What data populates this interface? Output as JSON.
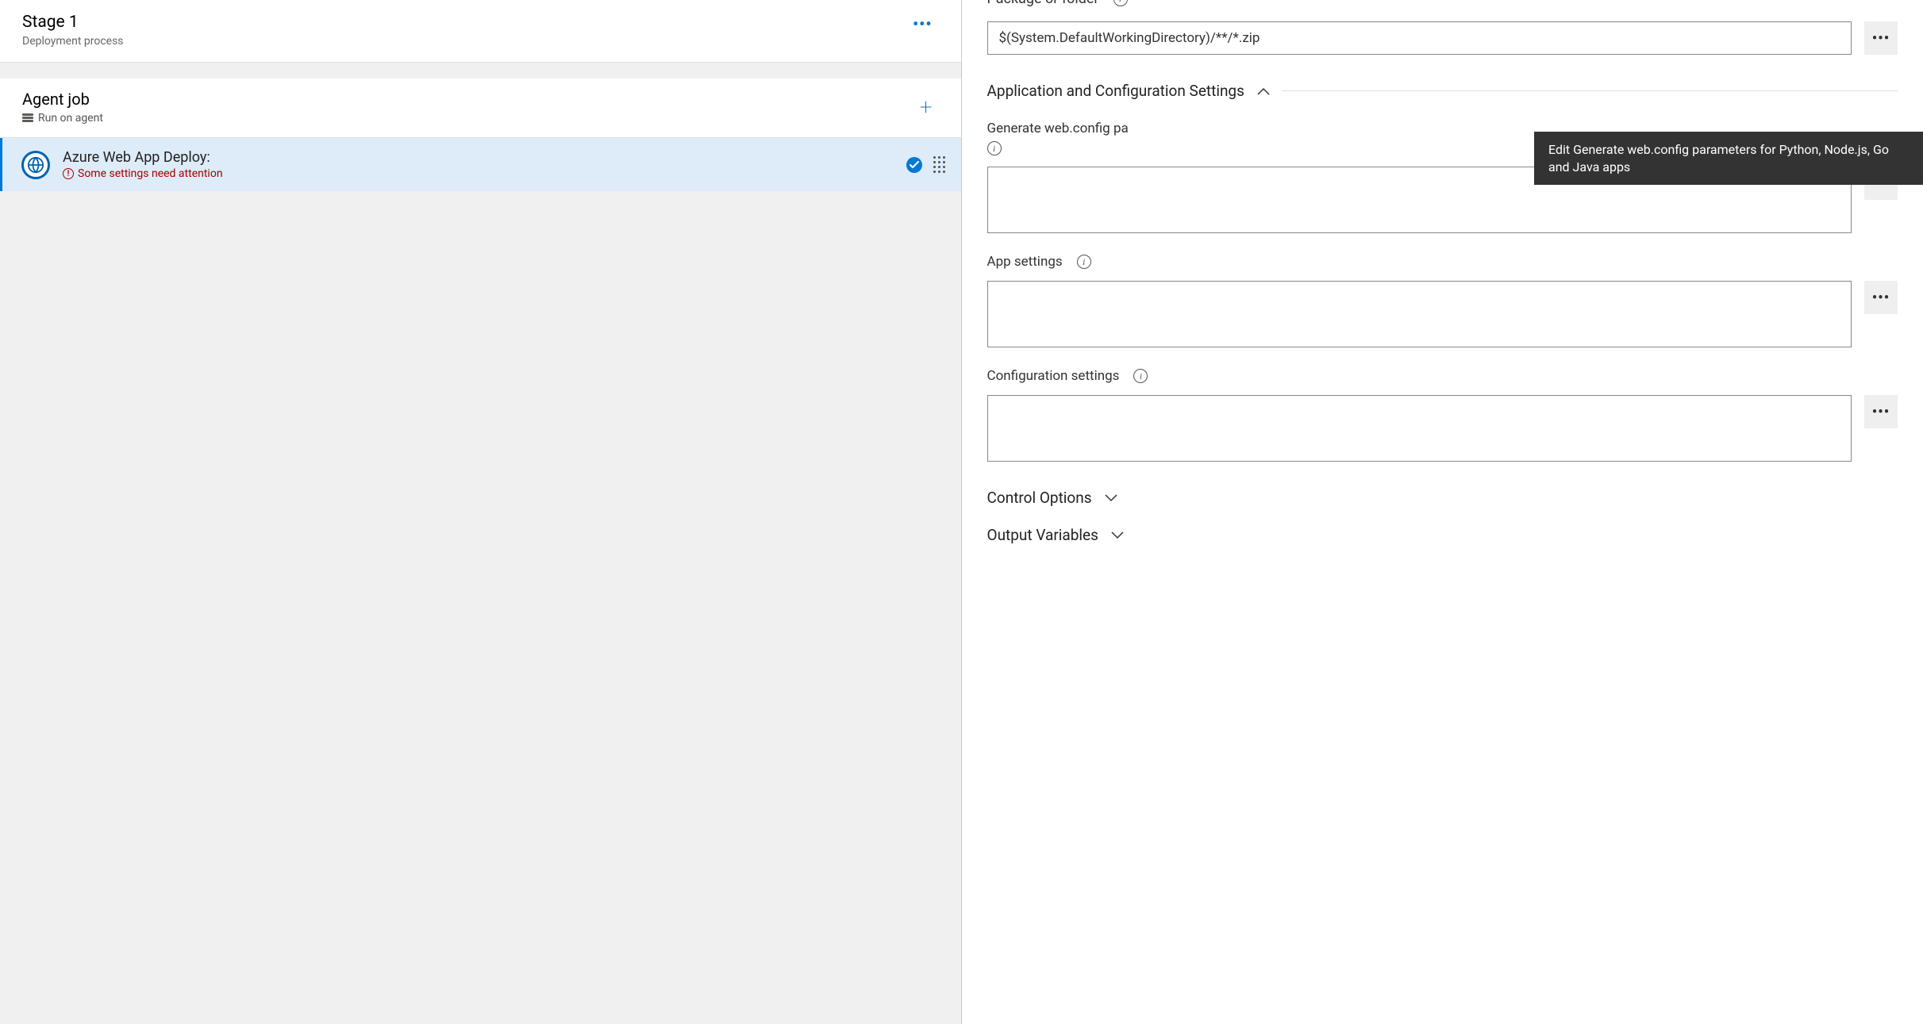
{
  "stage": {
    "title": "Stage 1",
    "subtitle": "Deployment process"
  },
  "agent": {
    "title": "Agent job",
    "subtitle": "Run on agent"
  },
  "task": {
    "title": "Azure Web App Deploy:",
    "warning": "Some settings need attention"
  },
  "right": {
    "package_label": "Package or folder",
    "package_value": "$(System.DefaultWorkingDirectory)/**/*.zip",
    "section_app_config": "Application and Configuration Settings",
    "gen_webconfig_label": "Generate web.config parameters for Python, Node.js, Go and Java apps",
    "gen_webconfig_visible_prefix": "Generate web.config pa",
    "gen_webconfig_value": "",
    "app_settings_label": "App settings",
    "app_settings_value": "",
    "config_settings_label": "Configuration settings",
    "config_settings_value": "",
    "section_control": "Control Options",
    "section_output": "Output Variables",
    "tooltip": "Edit Generate web.config parameters for Python, Node.js, Go and Java apps"
  }
}
